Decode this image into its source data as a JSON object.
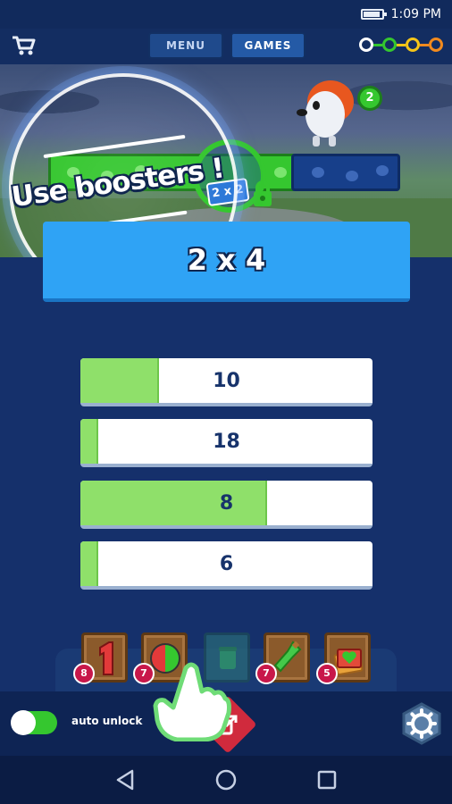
{
  "status": {
    "time": "1:09 PM"
  },
  "nav": {
    "tabs": [
      "MENU",
      "GAMES"
    ]
  },
  "progress_dots": [
    "#ffffff",
    "#35c72f",
    "#f5c518",
    "#f28a1e"
  ],
  "scene": {
    "enemy_level": "2",
    "booster_chip": "2 x 2"
  },
  "tutorial": {
    "text": "Use boosters !"
  },
  "question": {
    "text": "2 x 4"
  },
  "answers": [
    {
      "label": "10",
      "timer_fraction": 0.27
    },
    {
      "label": "18",
      "timer_fraction": 0.06
    },
    {
      "label": "8",
      "timer_fraction": 0.64
    },
    {
      "label": "6",
      "timer_fraction": 0.06
    }
  ],
  "boosters": [
    {
      "icon": "number-one-icon",
      "count": "8"
    },
    {
      "icon": "half-ball-icon",
      "count": "7"
    },
    {
      "icon": "cup-icon",
      "count": ""
    },
    {
      "icon": "bottle-icon",
      "count": "7"
    },
    {
      "icon": "heart-card-icon",
      "count": "5"
    }
  ],
  "bottom": {
    "auto_unlock_label": "auto unlock",
    "auto_unlock_on": true
  },
  "colors": {
    "accent_green": "#35c72f",
    "question_blue": "#2fa3f5",
    "answer_fill": "#8fe06a",
    "background": "#15306b"
  }
}
